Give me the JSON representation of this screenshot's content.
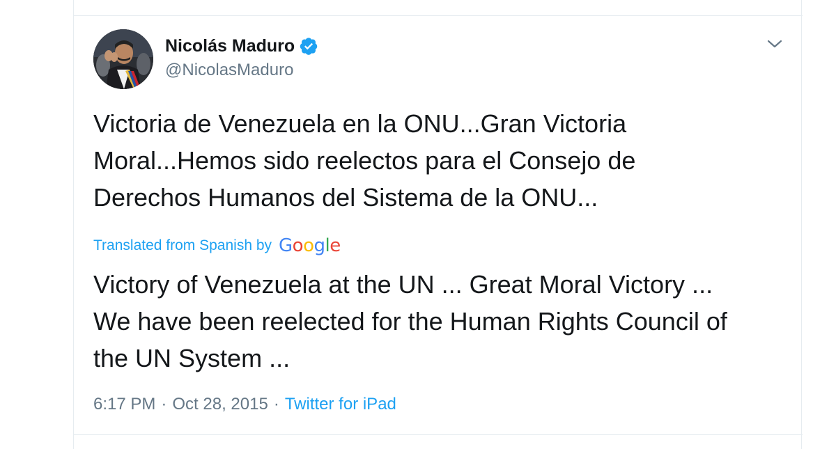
{
  "tweet": {
    "display_name": "Nicolás Maduro",
    "handle": "@NicolasMaduro",
    "verified": true,
    "text": "Victoria de Venezuela en la ONU...Gran Victoria\nMoral...Hemos sido reelectos para el Consejo de\nDerechos Humanos del Sistema de la ONU...",
    "translated_label": "Translated from Spanish by",
    "translation_provider": [
      "G",
      "o",
      "o",
      "g",
      "l",
      "e"
    ],
    "translation_text": "Victory of Venezuela at the UN ... Great Moral Victory ...\nWe have been reelected for the Human Rights Council of\nthe UN System ...",
    "time": "6:17 PM",
    "separator": "·",
    "date": "Oct 28, 2015",
    "source": "Twitter for iPad"
  },
  "icons": {
    "verified": "verified-badge-icon",
    "menu": "chevron-down-icon"
  },
  "colors": {
    "text_primary": "#14171a",
    "text_secondary": "#657786",
    "accent": "#1da1f2",
    "divider": "#e6ecf0",
    "google_blue": "#4285f4",
    "google_red": "#ea4335",
    "google_yellow": "#fbbc05",
    "google_green": "#34a853"
  }
}
